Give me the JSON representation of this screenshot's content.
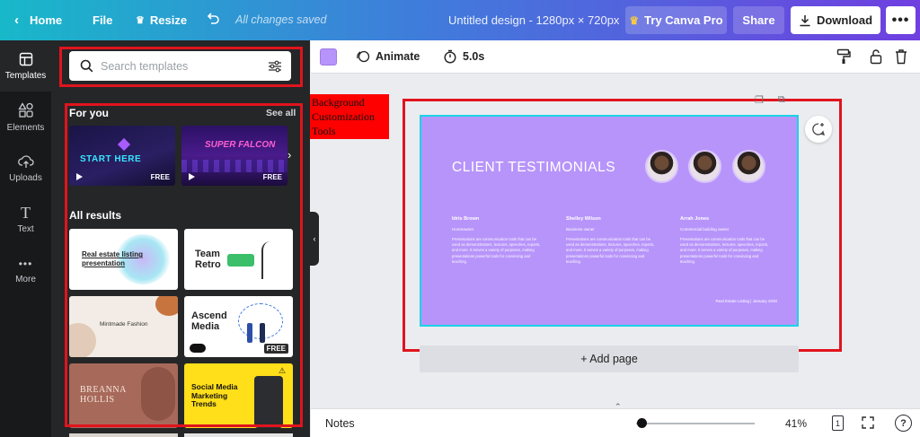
{
  "topbar": {
    "home": "Home",
    "file": "File",
    "resize": "Resize",
    "status": "All changes saved",
    "design_title": "Untitled design - 1280px × 720px",
    "try_pro": "Try Canva Pro",
    "share": "Share",
    "download": "Download"
  },
  "rail": {
    "items": [
      {
        "label": "Templates",
        "icon": "templates-icon"
      },
      {
        "label": "Elements",
        "icon": "elements-icon"
      },
      {
        "label": "Uploads",
        "icon": "upload-icon"
      },
      {
        "label": "Text",
        "icon": "text-icon"
      },
      {
        "label": "More",
        "icon": "more-icon"
      }
    ]
  },
  "panel": {
    "search_placeholder": "Search templates",
    "for_you": "For you",
    "see_all": "See all",
    "all_results": "All results",
    "for_you_thumbs": [
      {
        "title": "START HERE",
        "badge": "FREE"
      },
      {
        "title": "SUPER FALCON",
        "badge": "FREE"
      }
    ],
    "results": [
      {
        "title": "Real estate listing presentation",
        "badge": ""
      },
      {
        "title": "Team Retro",
        "badge": ""
      },
      {
        "title": "Mintmade Fashion",
        "badge": ""
      },
      {
        "title": "Ascend Media",
        "badge": "FREE"
      },
      {
        "title": "BREANNA HOLLIS",
        "badge": ""
      },
      {
        "title": "Social Media Marketing Trends",
        "badge": ""
      }
    ]
  },
  "toolbar": {
    "animate": "Animate",
    "duration": "5.0s",
    "color_swatch": "#b794fa"
  },
  "annotation": {
    "text": "Background Customization Tools",
    "color": "#fe0000"
  },
  "canvas": {
    "title": "CLIENT TESTIMONIALS",
    "background": "#b794fa",
    "testimonials": [
      {
        "name": "Idris Brown",
        "role": "Homeowner",
        "body": "Presentations are communication tools that can be used as demonstrations, lectures, speeches, reports, and more. It serves a variety of purposes, making presentations powerful tools for convincing and teaching."
      },
      {
        "name": "Shelley Wilson",
        "role": "Business owner",
        "body": "Presentations are communication tools that can be used as demonstrations, lectures, speeches, reports, and more. It serves a variety of purposes, making presentations powerful tools for convincing and teaching."
      },
      {
        "name": "Arrah Jones",
        "role": "Commercial building owner",
        "body": "Presentations are communication tools that can be used as demonstrations, lectures, speeches, reports, and more. It serves a variety of purposes, making presentations powerful tools for convincing and teaching."
      }
    ],
    "footer": "Real Estate Listing | January 2030",
    "add_page": "+ Add page"
  },
  "bottombar": {
    "notes": "Notes",
    "zoom": "41%",
    "page_count": "1"
  }
}
